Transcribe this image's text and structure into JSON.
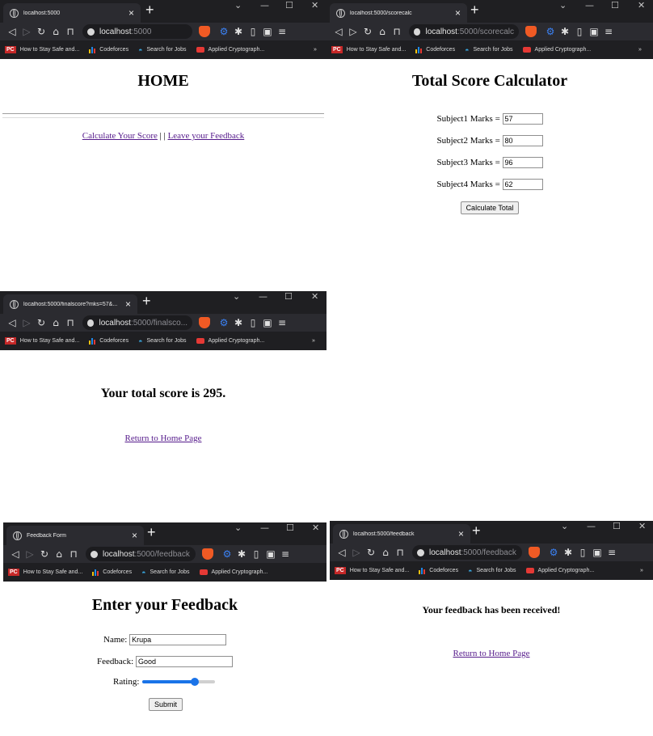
{
  "browser": {
    "bookmarks": [
      {
        "label": "How to Stay Safe and..."
      },
      {
        "label": "Codeforces"
      },
      {
        "label": "Search for Jobs"
      },
      {
        "label": "Applied Cryptograph..."
      }
    ],
    "more_bookmarks": "»",
    "new_tab": "+",
    "close_tab": "×"
  },
  "home": {
    "tab_title": "localhost:5000",
    "url_host": "localhost",
    "url_path": ":5000",
    "heading": "HOME",
    "link_calc": "Calculate Your Score",
    "separator": " | | ",
    "link_feedback": "Leave your Feedback"
  },
  "calc": {
    "tab_title": "localhost:5000/scorecalc",
    "url_host": "localhost",
    "url_path": ":5000/scorecalc",
    "heading": "Total Score Calculator",
    "fields": [
      {
        "label": "Subject1 Marks =",
        "value": "57"
      },
      {
        "label": "Subject2 Marks =",
        "value": "80"
      },
      {
        "label": "Subject3 Marks =",
        "value": "96"
      },
      {
        "label": "Subject4 Marks =",
        "value": "62"
      }
    ],
    "button": "Calculate Total"
  },
  "result": {
    "tab_title": "localhost:5000/finalscore?mks=57&...",
    "url_host": "localhost",
    "url_path": ":5000/finalsco...",
    "message": "Your total score is 295.",
    "link_home": "Return to Home Page"
  },
  "feedback": {
    "tab_title": "Feedback Form",
    "url_host": "localhost",
    "url_path": ":5000/feedback",
    "heading": "Enter your Feedback",
    "name_label": "Name:",
    "name_value": "Krupa",
    "feedback_label": "Feedback:",
    "feedback_value": "Good",
    "rating_label": "Rating:",
    "rating_level": 0.75,
    "button": "Submit"
  },
  "received": {
    "tab_title": "localhost:5000/feedback",
    "url_host": "localhost",
    "url_path": ":5000/feedback",
    "message": "Your feedback has been received!",
    "link_home": "Return to Home Page"
  },
  "colors": {
    "chrome_dark": "#1f1f22",
    "chrome_mid": "#2b2b30",
    "link": "#551a8b",
    "slider_accent": "#1a73e8"
  }
}
